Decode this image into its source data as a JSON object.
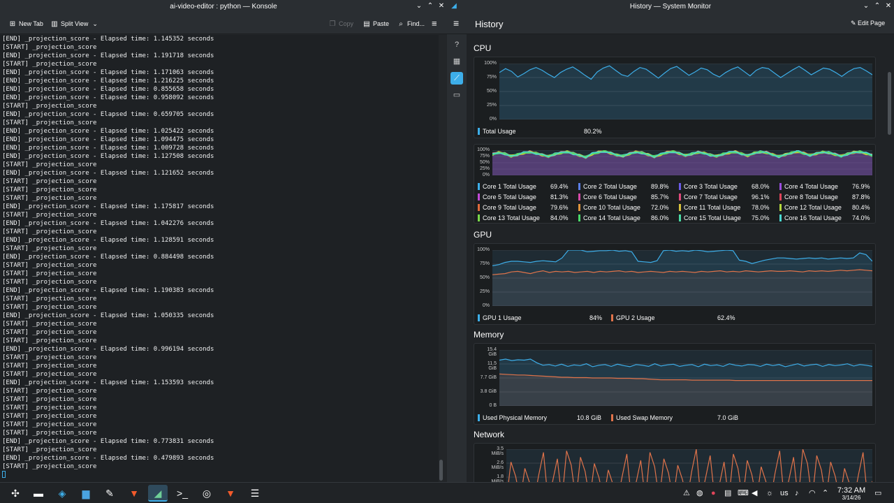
{
  "konsole": {
    "title": "ai-video-editor : python — Konsole",
    "toolbar": {
      "new_tab": "New Tab",
      "split_view": "Split View",
      "copy": "Copy",
      "paste": "Paste",
      "find": "Find..."
    },
    "lines": [
      "[END] _projection_score - Elapsed time: 1.145352 seconds",
      "[START] _projection_score",
      "[END] _projection_score - Elapsed time: 1.191718 seconds",
      "[START] _projection_score",
      "[END] _projection_score - Elapsed time: 1.171063 seconds",
      "[END] _projection_score - Elapsed time: 1.216225 seconds",
      "[END] _projection_score - Elapsed time: 0.855658 seconds",
      "[END] _projection_score - Elapsed time: 0.958092 seconds",
      "[START] _projection_score",
      "[END] _projection_score - Elapsed time: 0.659705 seconds",
      "[START] _projection_score",
      "[END] _projection_score - Elapsed time: 1.025422 seconds",
      "[END] _projection_score - Elapsed time: 1.094475 seconds",
      "[END] _projection_score - Elapsed time: 1.009728 seconds",
      "[END] _projection_score - Elapsed time: 1.127508 seconds",
      "[START] _projection_score",
      "[END] _projection_score - Elapsed time: 1.121652 seconds",
      "[START] _projection_score",
      "[START] _projection_score",
      "[START] _projection_score",
      "[END] _projection_score - Elapsed time: 1.175817 seconds",
      "[START] _projection_score",
      "[END] _projection_score - Elapsed time: 1.042276 seconds",
      "[START] _projection_score",
      "[END] _projection_score - Elapsed time: 1.128591 seconds",
      "[START] _projection_score",
      "[END] _projection_score - Elapsed time: 0.884498 seconds",
      "[START] _projection_score",
      "[START] _projection_score",
      "[START] _projection_score",
      "[END] _projection_score - Elapsed time: 1.190383 seconds",
      "[START] _projection_score",
      "[START] _projection_score",
      "[END] _projection_score - Elapsed time: 1.050335 seconds",
      "[START] _projection_score",
      "[START] _projection_score",
      "[START] _projection_score",
      "[END] _projection_score - Elapsed time: 0.996194 seconds",
      "[START] _projection_score",
      "[START] _projection_score",
      "[START] _projection_score",
      "[END] _projection_score - Elapsed time: 1.153593 seconds",
      "[START] _projection_score",
      "[START] _projection_score",
      "[START] _projection_score",
      "[START] _projection_score",
      "[START] _projection_score",
      "[START] _projection_score",
      "[END] _projection_score - Elapsed time: 0.773831 seconds",
      "[START] _projection_score",
      "[END] _projection_score - Elapsed time: 0.479893 seconds",
      "[START] _projection_score"
    ]
  },
  "sysmon": {
    "title": "History — System Monitor",
    "page_title": "History",
    "edit_page": "Edit Page",
    "cpu": {
      "title": "CPU",
      "yticks": [
        "100%",
        "75%",
        "50%",
        "25%",
        "0%"
      ],
      "total_label": "Total Usage",
      "total_value": "80.2%",
      "total_series": [
        84,
        91,
        86,
        76,
        82,
        89,
        93,
        88,
        81,
        75,
        84,
        90,
        94,
        87,
        79,
        72,
        85,
        92,
        96,
        88,
        80,
        77,
        86,
        93,
        90,
        82,
        74,
        83,
        91,
        95,
        87,
        79,
        85,
        92,
        89,
        81,
        76,
        84,
        90,
        94,
        86,
        78,
        88,
        93,
        91,
        83,
        75,
        82,
        89,
        95,
        88,
        80,
        86,
        92,
        90,
        84,
        77,
        85,
        91,
        93,
        87,
        80
      ],
      "core_yticks": [
        "100%",
        "75%",
        "50%",
        "25%",
        "0%"
      ],
      "cores": [
        {
          "label": "Core 1 Total Usage",
          "value": "69.4%",
          "color": "#3daee9"
        },
        {
          "label": "Core 2 Total Usage",
          "value": "89.8%",
          "color": "#5b7fe8"
        },
        {
          "label": "Core 3 Total Usage",
          "value": "68.0%",
          "color": "#6a5be8"
        },
        {
          "label": "Core 4 Total Usage",
          "value": "76.9%",
          "color": "#9b4de0"
        },
        {
          "label": "Core 5 Total Usage",
          "value": "81.3%",
          "color": "#c14ad6"
        },
        {
          "label": "Core 6 Total Usage",
          "value": "85.7%",
          "color": "#d64aa8"
        },
        {
          "label": "Core 7 Total Usage",
          "value": "96.1%",
          "color": "#e04a7b"
        },
        {
          "label": "Core 8 Total Usage",
          "value": "87.8%",
          "color": "#e0455a"
        },
        {
          "label": "Core 9 Total Usage",
          "value": "79.6%",
          "color": "#e06a3c"
        },
        {
          "label": "Core 10 Total Usage",
          "value": "72.0%",
          "color": "#e0953c"
        },
        {
          "label": "Core 11 Total Usage",
          "value": "78.0%",
          "color": "#d9c23c"
        },
        {
          "label": "Core 12 Total Usage",
          "value": "80.4%",
          "color": "#b6d93c"
        },
        {
          "label": "Core 13 Total Usage",
          "value": "84.0%",
          "color": "#7ad94a"
        },
        {
          "label": "Core 14 Total Usage",
          "value": "86.0%",
          "color": "#4ad96a"
        },
        {
          "label": "Core 15 Total Usage",
          "value": "75.0%",
          "color": "#4ad9a4"
        },
        {
          "label": "Core 16 Total Usage",
          "value": "74.0%",
          "color": "#4ad9d2"
        }
      ]
    },
    "gpu": {
      "title": "GPU",
      "yticks": [
        "100%",
        "75%",
        "50%",
        "25%",
        "0%"
      ],
      "gpu1_label": "GPU 1 Usage",
      "gpu1_value": "84%",
      "gpu2_label": "GPU 2 Usage",
      "gpu2_value": "62.4%",
      "gpu1_series": [
        72,
        74,
        78,
        80,
        80,
        79,
        78,
        80,
        81,
        80,
        79,
        86,
        100,
        100,
        100,
        97,
        98,
        99,
        99,
        100,
        98,
        99,
        97,
        80,
        79,
        78,
        81,
        99,
        100,
        98,
        99,
        98,
        100,
        99,
        97,
        98,
        99,
        100,
        99,
        82,
        80,
        76,
        79,
        82,
        84,
        86,
        86,
        85,
        84,
        85,
        86,
        85,
        86,
        84,
        85,
        86,
        85,
        86,
        95,
        92,
        80
      ],
      "gpu2_series": [
        56,
        57,
        58,
        61,
        62,
        60,
        58,
        61,
        63,
        60,
        62,
        61,
        62,
        60,
        61,
        62,
        60,
        62,
        61,
        62,
        63,
        61,
        62,
        60,
        61,
        62,
        61,
        60,
        62,
        61,
        62,
        61,
        60,
        62,
        61,
        62,
        63,
        61,
        62,
        61,
        63,
        62,
        61,
        62,
        63,
        62,
        62,
        63,
        62,
        61,
        63,
        62,
        63,
        62,
        63,
        64,
        63,
        64,
        65,
        64,
        63
      ]
    },
    "memory": {
      "title": "Memory",
      "yticks": [
        "15.4 GiB",
        "11.5 GiB",
        "7.7 GiB",
        "3.8 GiB",
        "0 B"
      ],
      "phys_label": "Used Physical Memory",
      "phys_value": "10.8 GiB",
      "swap_label": "Used Swap Memory",
      "swap_value": "7.0 GiB",
      "phys_series": [
        12.6,
        12.9,
        12.5,
        12.7,
        12.6,
        12.9,
        11.9,
        11.2,
        11.4,
        11.0,
        11.5,
        10.9,
        11.3,
        11.1,
        11.6,
        10.8,
        11.2,
        11.4,
        10.9,
        11.5,
        11.1,
        10.8,
        11.4,
        11.2,
        10.9,
        11.6,
        11.0,
        11.3,
        11.5,
        10.9,
        11.2,
        11.4,
        10.8,
        11.5,
        11.1,
        11.3,
        10.9,
        11.6,
        11.2,
        11.0,
        11.4,
        11.3,
        10.9,
        11.5,
        11.1,
        11.4,
        10.8,
        11.2,
        11.6,
        11.0,
        11.3,
        11.5,
        10.9,
        11.4,
        11.1,
        11.3,
        11.6,
        11.0,
        11.4,
        11.2,
        10.9
      ],
      "swap_series": [
        8.8,
        8.7,
        8.6,
        8.5,
        8.5,
        8.4,
        8.3,
        8.2,
        8.1,
        8.0,
        7.9,
        7.9,
        7.8,
        7.8,
        7.8,
        7.7,
        7.7,
        7.7,
        7.7,
        7.6,
        7.6,
        7.6,
        7.5,
        7.5,
        7.4,
        7.3,
        7.2,
        7.2,
        7.2,
        7.2,
        7.2,
        7.1,
        7.1,
        7.1,
        7.1,
        7.1,
        7.1,
        7.1,
        7.0,
        7.0,
        7.0,
        7.0,
        7.0,
        7.0,
        7.0,
        7.0,
        7.0,
        7.0,
        7.0,
        7.0,
        7.0,
        7.0,
        7.0,
        7.0,
        7.0,
        7.0,
        7.0,
        7.0,
        7.0,
        7.0,
        7.0
      ]
    },
    "network": {
      "title": "Network",
      "yticks": [
        "3.5 MiB/s",
        "2.6 MiB/s",
        "1.8 MiB/s"
      ]
    }
  },
  "taskbar": {
    "keyboard_layout": "us",
    "time": "7:32 AM",
    "date": "3/14/26"
  },
  "colors": {
    "accent": "#3daee9",
    "orange": "#e0734a",
    "purple_fill": "#7d4fa8"
  }
}
